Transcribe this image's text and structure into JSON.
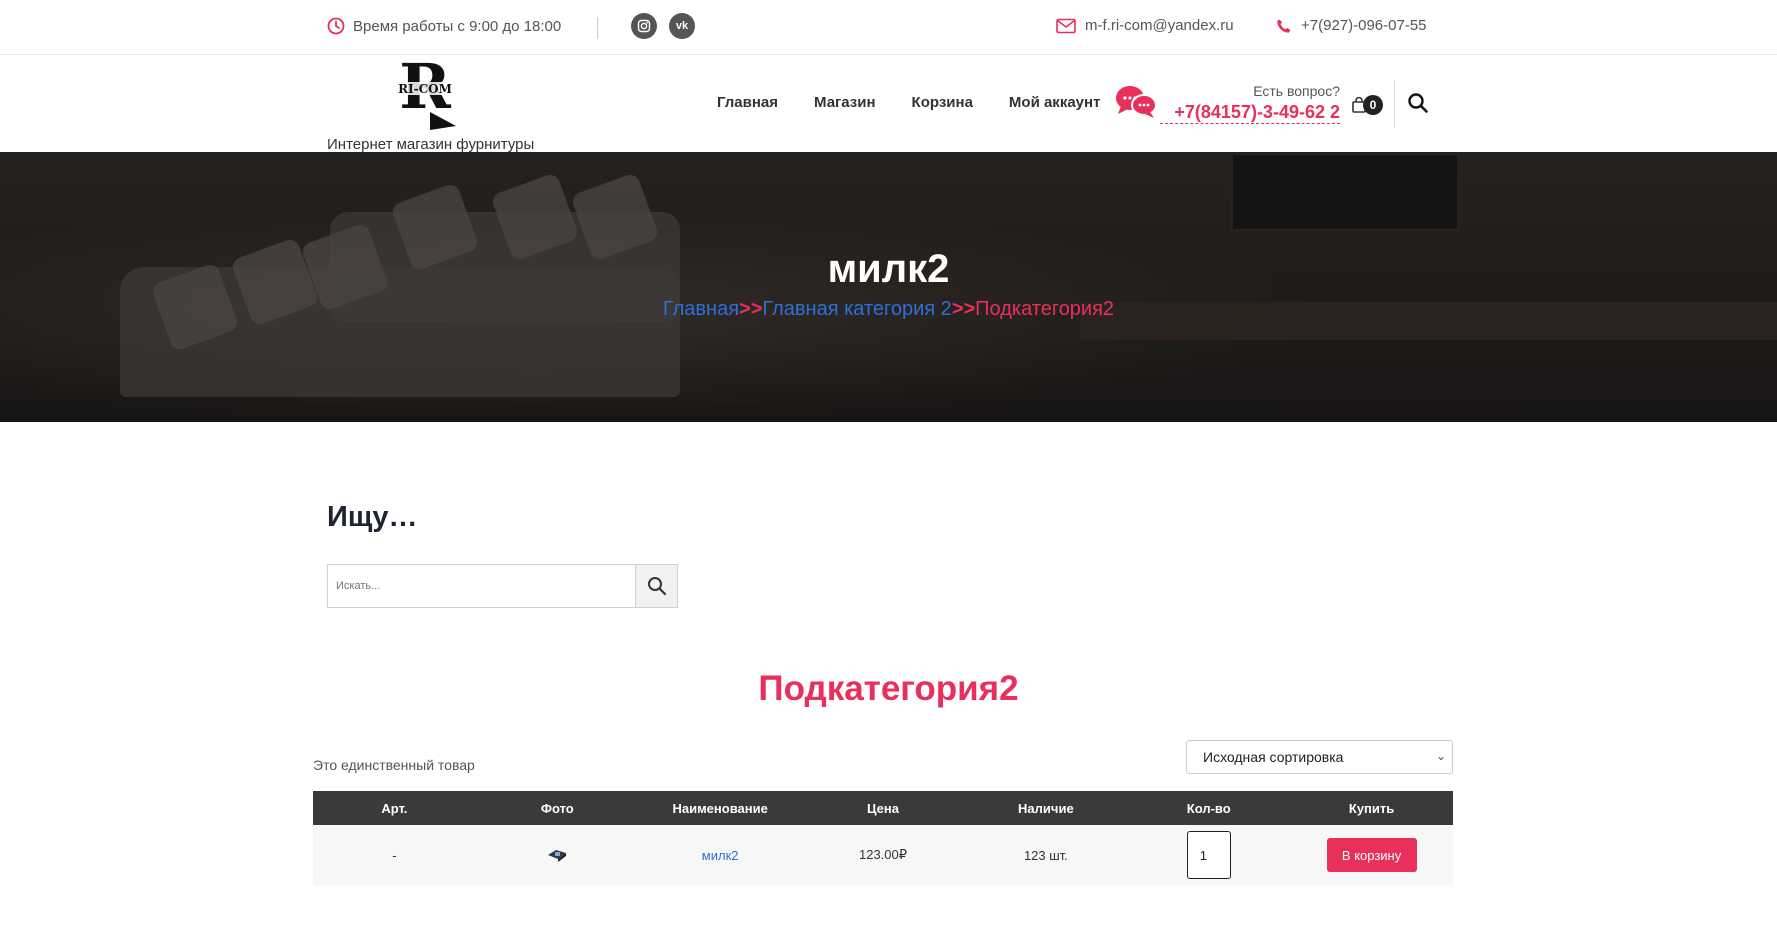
{
  "topbar": {
    "hours": "Время работы с 9:00 до 18:00",
    "social": [
      {
        "icon": "instagram-icon",
        "glyph": "◎"
      },
      {
        "icon": "vk-icon",
        "glyph": "vk"
      }
    ],
    "email": "m-f.ri-com@yandex.ru",
    "phone": "+7(927)-096-07-55"
  },
  "header": {
    "logo_text": "RI-COM",
    "tagline": "Интернет магазин фурнитуры",
    "nav": [
      "Главная",
      "Магазин",
      "Корзина",
      "Мой аккаунт"
    ],
    "question": "Есть вопрос?",
    "phone": "+7(84157)-3-49-62 2",
    "cart_count": "0"
  },
  "hero": {
    "title": "милк2",
    "breadcrumb": {
      "home": "Главная",
      "separator": ">>",
      "category": "Главная категория 2",
      "current": "Подкатегория2"
    }
  },
  "search": {
    "title": "Ищу…",
    "placeholder": "Искать..."
  },
  "category": {
    "title": "Подкатегория2",
    "count_text": "Это единственный товар",
    "sort_selected": "Исходная сортировка"
  },
  "table": {
    "headers": [
      "Арт.",
      "Фото",
      "Наименование",
      "Цена",
      "Наличие",
      "Кол-во",
      "Купить"
    ],
    "rows": [
      {
        "sku": "-",
        "name": "милк2",
        "price": "123.00₽",
        "stock": "123 шт.",
        "qty": "1",
        "buy": "В корзину"
      }
    ]
  },
  "colors": {
    "accent": "#e8305a",
    "link": "#2e6fd9",
    "table_header": "#3a3a3a"
  }
}
